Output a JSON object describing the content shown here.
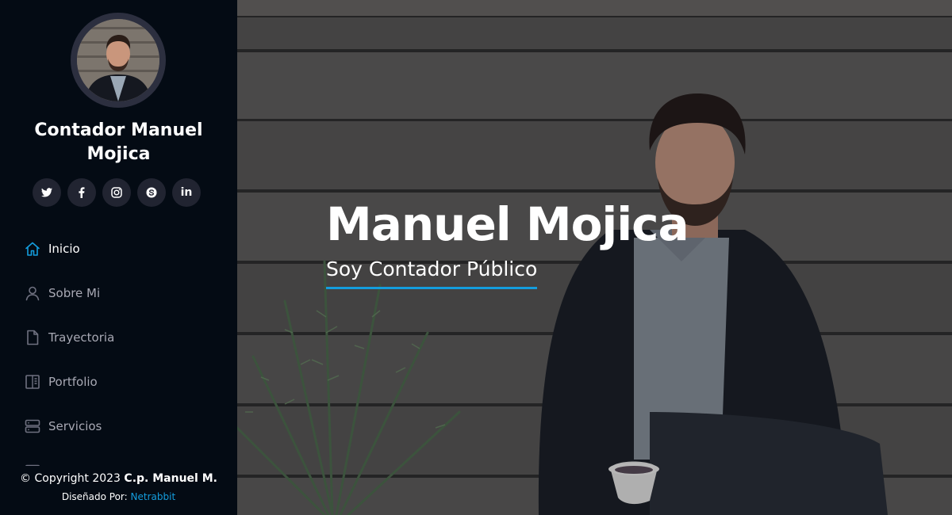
{
  "sidebar": {
    "profile_name": "Contador Manuel Mojica",
    "social": [
      {
        "name": "twitter",
        "icon": "twitter-icon"
      },
      {
        "name": "facebook",
        "icon": "facebook-icon"
      },
      {
        "name": "instagram",
        "icon": "instagram-icon"
      },
      {
        "name": "skype",
        "icon": "skype-icon"
      },
      {
        "name": "linkedin",
        "icon": "linkedin-icon",
        "glyph": "in"
      }
    ],
    "nav": [
      {
        "label": "Inicio",
        "icon": "home-icon",
        "active": true
      },
      {
        "label": "Sobre Mi",
        "icon": "person-icon"
      },
      {
        "label": "Trayectoria",
        "icon": "file-icon"
      },
      {
        "label": "Portfolio",
        "icon": "book-half-icon"
      },
      {
        "label": "Servicios",
        "icon": "server-icon"
      }
    ]
  },
  "footer": {
    "copyright_prefix": "© Copyright 2023",
    "copyright_name": "C.p. Manuel M.",
    "credits_prefix": "Diseñado Por:",
    "credits_link": "Netrabbit"
  },
  "hero": {
    "title": "Manuel Mojica",
    "subtitle": "Soy Contador Público"
  },
  "colors": {
    "accent": "#149ddd",
    "sidebar_bg": "#040b14",
    "nav_text": "#a8a9b4",
    "social_bg": "#212431"
  }
}
